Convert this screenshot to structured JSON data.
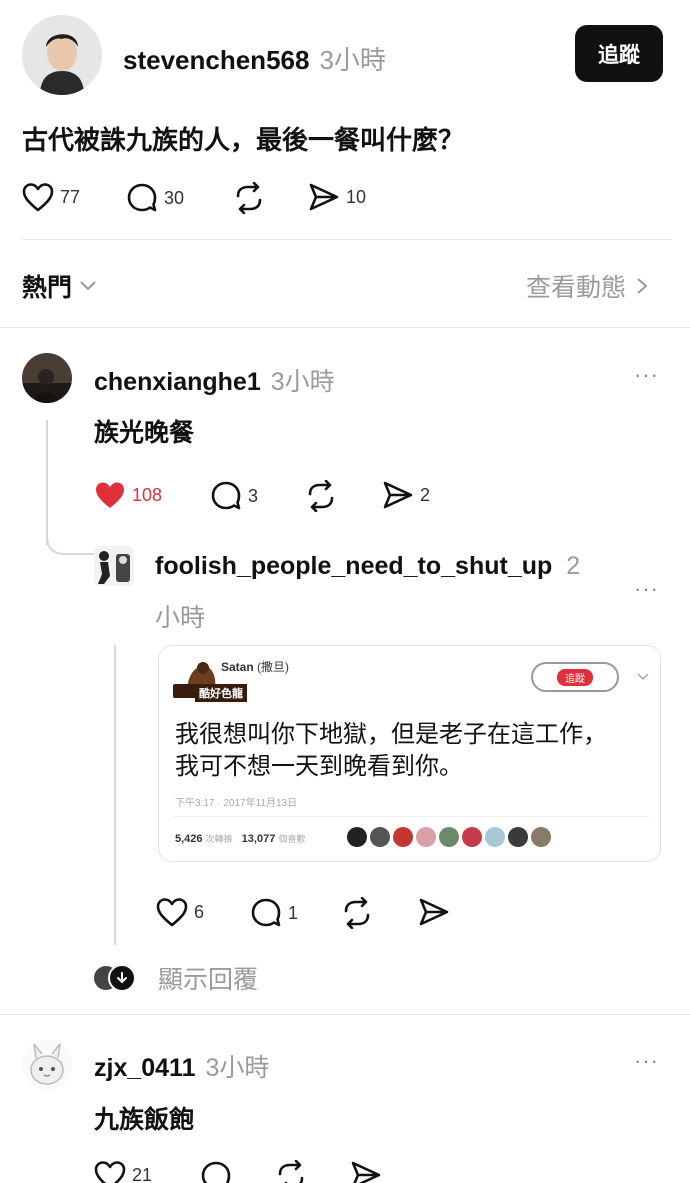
{
  "post": {
    "username": "stevenchen568",
    "time": "3小時",
    "follow_label": "追蹤",
    "text": "古代被誅九族的人，最後一餐叫什麼？",
    "likes": "77",
    "comments": "30",
    "shares": "10"
  },
  "filter": {
    "sort_label": "熱門",
    "activity_label": "查看動態"
  },
  "replies": [
    {
      "username": "chenxianghe1",
      "time": "3小時",
      "text": "族光晚餐",
      "likes": "108",
      "comments": "3",
      "shares": "2",
      "liked": true
    },
    {
      "username": "foolish_people_need_to_shut_up",
      "time_part1": "2",
      "time_part2": "小時",
      "likes": "6",
      "comments": "1",
      "embed": {
        "author": "Satan",
        "author_suffix": "(撒旦)",
        "handle": "酷好色龍",
        "button_label": "追蹤",
        "text_line1": "我很想叫你下地獄，但是老子在這工作，",
        "text_line2": "我可不想一天到晚看到你。",
        "timestamp": "下午3:17 · 2017年11月13日",
        "retweets": "5,426",
        "retweets_label": "次轉推",
        "likes": "13,077",
        "likes_label": "個喜歡"
      }
    },
    {
      "username": "zjx_0411",
      "time": "3小時",
      "text": "九族飯飽",
      "likes": "21"
    }
  ],
  "show_replies_label": "顯示回覆",
  "colors": {
    "like_red": "#e0303a",
    "text": "#111111",
    "muted": "#9a9a9a"
  }
}
